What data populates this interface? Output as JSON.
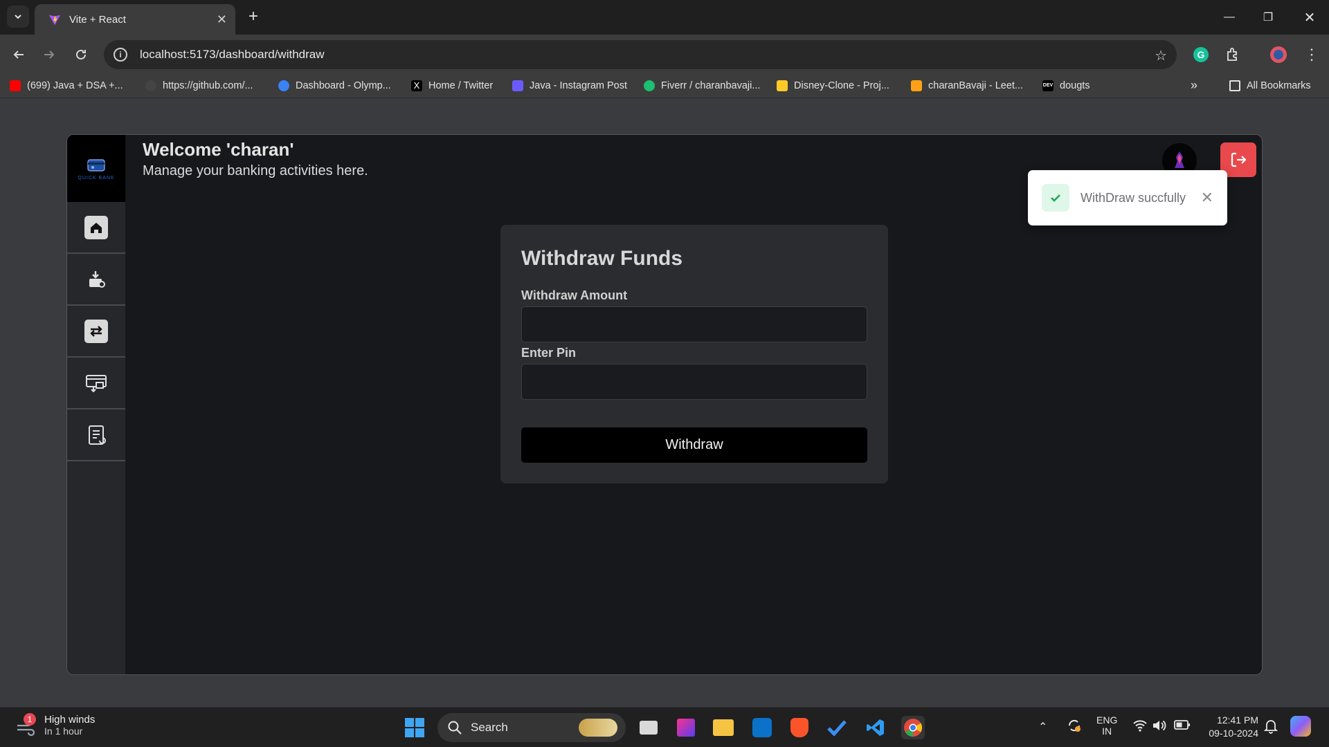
{
  "browser": {
    "tab_title": "Vite + React",
    "url": "localhost:5173/dashboard/withdraw",
    "bookmarks": [
      {
        "label": "(699) Java + DSA +...",
        "icon": "youtube-icon",
        "color": "#ff0000"
      },
      {
        "label": "https://github.com/...",
        "icon": "github-icon",
        "color": "#f0f0f0"
      },
      {
        "label": "Dashboard - Olymp...",
        "icon": "olympus-icon",
        "color": "#3b82f6"
      },
      {
        "label": "Home / Twitter",
        "icon": "x-icon",
        "color": "#000000"
      },
      {
        "label": "Java - Instagram Post",
        "icon": "heart-icon",
        "color": "#6b5bff"
      },
      {
        "label": "Fiverr / charanbavaji...",
        "icon": "fiverr-icon",
        "color": "#1dbf73"
      },
      {
        "label": "Disney-Clone - Proj...",
        "icon": "firebase-icon",
        "color": "#ffca28"
      },
      {
        "label": "charanBavaji - Leet...",
        "icon": "leetcode-icon",
        "color": "#ffa116"
      },
      {
        "label": "dougts",
        "icon": "dev-icon",
        "color": "#000000"
      }
    ],
    "all_bookmarks": "All Bookmarks"
  },
  "app": {
    "logo_text": "QUICK BANK",
    "welcome": "Welcome 'charan'",
    "subtitle": "Manage your banking activities here.",
    "sidebar": [
      {
        "name": "home",
        "icon": "home-icon"
      },
      {
        "name": "deposit",
        "icon": "deposit-icon"
      },
      {
        "name": "transfer",
        "icon": "transfer-icon"
      },
      {
        "name": "withdraw",
        "icon": "atm-withdraw-icon"
      },
      {
        "name": "transactions",
        "icon": "transactions-icon"
      }
    ],
    "colors": {
      "accent_logout": "#e9494c",
      "toast_success": "#1fa85a"
    }
  },
  "form": {
    "title": "Withdraw Funds",
    "amount_label": "Withdraw Amount",
    "amount_value": "",
    "pin_label": "Enter Pin",
    "pin_value": "",
    "submit_label": "Withdraw"
  },
  "toast": {
    "message": "WithDraw succfully"
  },
  "taskbar": {
    "weather_badge": "1",
    "weather_title": "High winds",
    "weather_sub": "In 1 hour",
    "search_label": "Search",
    "lang_top": "ENG",
    "lang_bottom": "IN",
    "time": "12:41 PM",
    "date": "09-10-2024"
  }
}
